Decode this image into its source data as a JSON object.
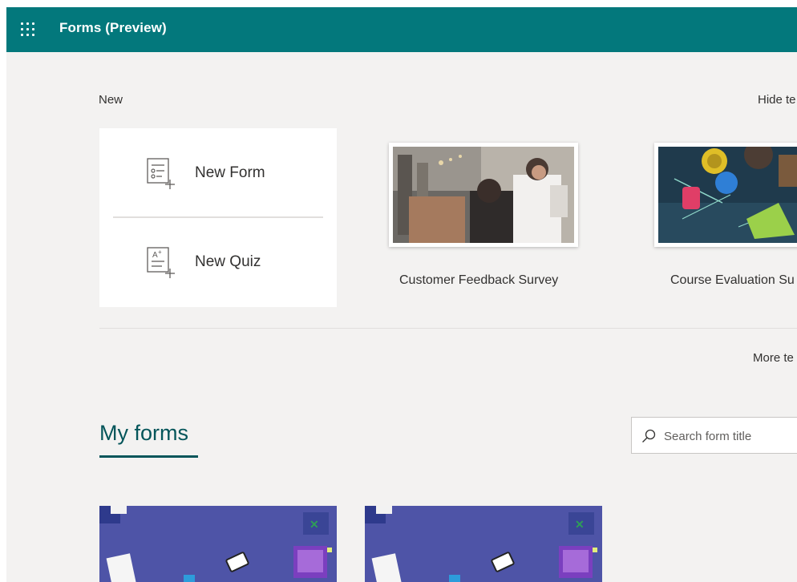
{
  "header": {
    "app_title": "Forms (Preview)",
    "waffle_icon": "app-launcher-icon",
    "color": "#03787c"
  },
  "new_section": {
    "label": "New",
    "hide_link": "Hide te",
    "items": [
      {
        "label": "New Form",
        "icon": "new-form-icon"
      },
      {
        "label": "New Quiz",
        "icon": "new-quiz-icon"
      }
    ]
  },
  "templates": [
    {
      "label": "Customer Feedback Survey"
    },
    {
      "label": "Course Evaluation Su"
    }
  ],
  "more_link": "More te",
  "my_forms": {
    "tab_label": "My forms",
    "accent": "#04555a",
    "search": {
      "placeholder": "Search form title",
      "value": ""
    },
    "cards": [
      {
        "icon": "excel-icon"
      },
      {
        "icon": "excel-icon"
      }
    ]
  }
}
